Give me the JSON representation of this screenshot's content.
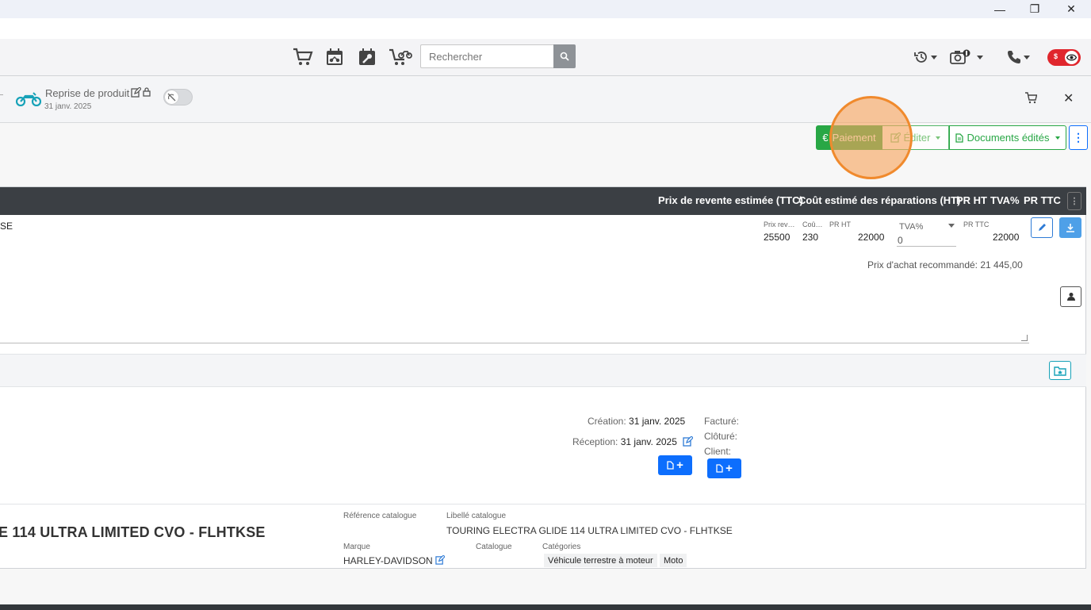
{
  "window": {
    "minimize": "—",
    "maximize": "❐",
    "close": "✕"
  },
  "topnav": {
    "icons": [
      "cart-icon",
      "calendar-moto-icon",
      "wrench-calendar-icon",
      "cart-moto-icon"
    ],
    "search_placeholder": "Rechercher",
    "toggle_dollar": "$"
  },
  "subheader": {
    "title": "Reprise de produit",
    "date": "31 janv. 2025"
  },
  "actions": {
    "payment": "Paiement",
    "edit": "Éditer",
    "documents": "Documents édités",
    "more": "⋮"
  },
  "table": {
    "headers": [
      "Prix de revente estimée (TTC)",
      "Coût estimé des réparations (HT)",
      "PR HT",
      "TVA%",
      "PR TTC"
    ],
    "row_fragment": "SE",
    "mini_labels": {
      "resale": "Prix rev…",
      "cost": "Coû…",
      "pr_ht": "PR HT",
      "pr_ttc": "PR TTC"
    },
    "values": {
      "resale": "25500",
      "cost": "230",
      "pr_ht": "22000",
      "pr_ttc": "22000"
    },
    "tva": {
      "label": "TVA%",
      "value": "0"
    },
    "recommended_label": "Prix d'achat recommandé:",
    "recommended_value": "21 445,00"
  },
  "dates": {
    "creation_label": "Création:",
    "creation_value": "31 janv. 2025",
    "reception_label": "Réception:",
    "reception_value": "31 janv. 2025",
    "invoiced_label": "Facturé:",
    "closed_label": "Clôturé:",
    "client_label": "Client:",
    "add_doc": "+"
  },
  "product": {
    "title": "E 114 ULTRA LIMITED CVO - FLHTKSE",
    "ref_label": "Référence catalogue",
    "libelle_label": "Libellé catalogue",
    "libelle_value": "TOURING ELECTRA GLIDE 114 ULTRA LIMITED CVO - FLHTKSE",
    "brand_label": "Marque",
    "brand_value": "HARLEY-DAVIDSON",
    "catalogue_label": "Catalogue",
    "categories_label": "Catégories",
    "categories": [
      "Véhicule terrestre à moteur",
      "Moto"
    ]
  },
  "colors": {
    "success": "#28a745",
    "primary": "#0d6efd",
    "dark_header": "#3b3f44",
    "danger": "#e0262d",
    "click_marker": "#f08a2d"
  }
}
